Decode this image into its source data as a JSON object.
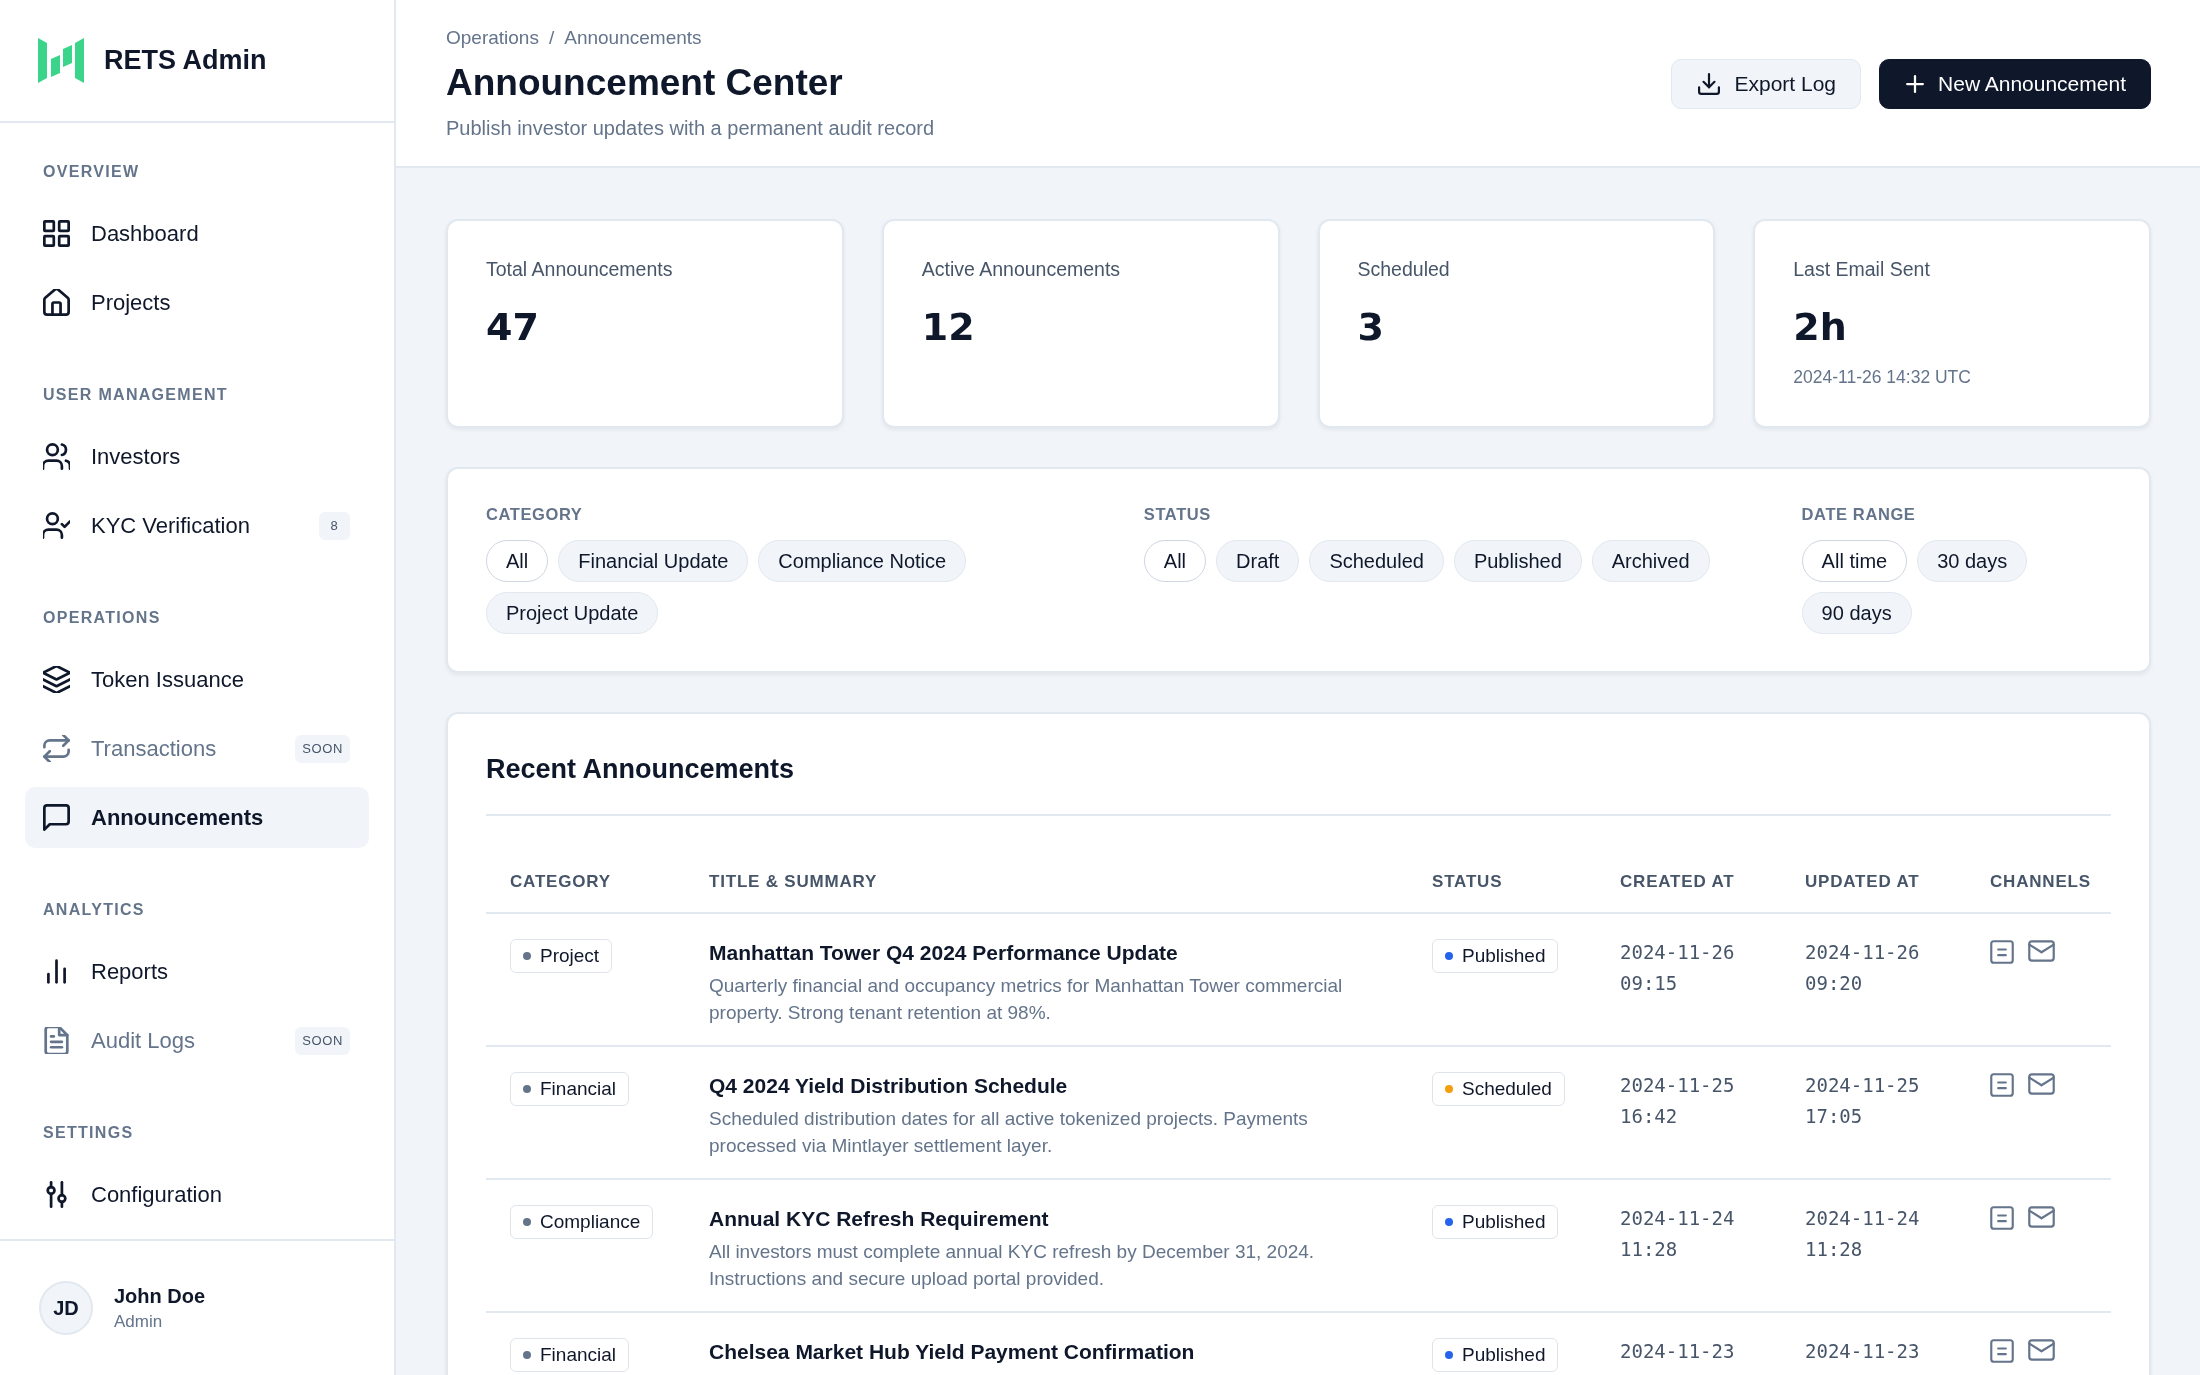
{
  "brand": {
    "name": "RETS Admin"
  },
  "sidebar": {
    "sections": [
      {
        "title": "OVERVIEW",
        "items": [
          {
            "label": "Dashboard",
            "selected": false,
            "disabled": false
          },
          {
            "label": "Projects",
            "selected": false,
            "disabled": false
          }
        ]
      },
      {
        "title": "USER MANAGEMENT",
        "items": [
          {
            "label": "Investors",
            "selected": false,
            "disabled": false
          },
          {
            "label": "KYC Verification",
            "selected": false,
            "disabled": false,
            "badge": "8"
          }
        ]
      },
      {
        "title": "OPERATIONS",
        "items": [
          {
            "label": "Token Issuance",
            "selected": false,
            "disabled": false
          },
          {
            "label": "Transactions",
            "selected": false,
            "disabled": true,
            "badge": "SOON"
          },
          {
            "label": "Announcements",
            "selected": true,
            "disabled": false
          }
        ]
      },
      {
        "title": "ANALYTICS",
        "items": [
          {
            "label": "Reports",
            "selected": false,
            "disabled": false
          },
          {
            "label": "Audit Logs",
            "selected": false,
            "disabled": true,
            "badge": "SOON"
          }
        ]
      },
      {
        "title": "SETTINGS",
        "items": [
          {
            "label": "Configuration",
            "selected": false,
            "disabled": false
          }
        ]
      }
    ]
  },
  "user": {
    "initials": "JD",
    "name": "John Doe",
    "role": "Admin"
  },
  "header": {
    "breadcrumb": [
      "Operations",
      "Announcements"
    ],
    "breadcrumb_separator": "/",
    "title": "Announcement Center",
    "subtitle": "Publish investor updates with a permanent audit record",
    "buttons": [
      {
        "label": "Export Log",
        "kind": "secondary"
      },
      {
        "label": "New Announcement",
        "kind": "primary"
      }
    ]
  },
  "stats": [
    {
      "label": "Total Announcements",
      "value": "47"
    },
    {
      "label": "Active Announcements",
      "value": "12"
    },
    {
      "label": "Scheduled",
      "value": "3"
    },
    {
      "label": "Last Email Sent",
      "value": "2h",
      "detail": "2024-11-26 14:32 UTC"
    }
  ],
  "filters": [
    {
      "title": "CATEGORY",
      "options": [
        {
          "label": "All",
          "selected": true
        },
        {
          "label": "Financial Update",
          "selected": false
        },
        {
          "label": "Compliance Notice",
          "selected": false
        },
        {
          "label": "Project Update",
          "selected": false
        }
      ]
    },
    {
      "title": "STATUS",
      "options": [
        {
          "label": "All",
          "selected": true
        },
        {
          "label": "Draft",
          "selected": false
        },
        {
          "label": "Scheduled",
          "selected": false
        },
        {
          "label": "Published",
          "selected": false
        },
        {
          "label": "Archived",
          "selected": false
        }
      ]
    },
    {
      "title": "DATE RANGE",
      "options": [
        {
          "label": "All time",
          "selected": true
        },
        {
          "label": "30 days",
          "selected": false
        },
        {
          "label": "90 days",
          "selected": false
        }
      ]
    }
  ],
  "table": {
    "title": "Recent Announcements",
    "columns": [
      "CATEGORY",
      "TITLE & SUMMARY",
      "STATUS",
      "CREATED AT",
      "UPDATED AT",
      "CHANNELS"
    ],
    "rows": [
      {
        "category": "Project",
        "title": "Manhattan Tower Q4 2024 Performance Update",
        "summary": "Quarterly financial and occupancy metrics for Manhattan Tower commercial property. Strong tenant retention at 98%.",
        "status": {
          "label": "Published",
          "color": "#2563eb"
        },
        "created_at": "2024-11-26 09:15",
        "updated_at": "2024-11-26 09:20"
      },
      {
        "category": "Financial",
        "title": "Q4 2024 Yield Distribution Schedule",
        "summary": "Scheduled distribution dates for all active tokenized projects. Payments processed via Mintlayer settlement layer.",
        "status": {
          "label": "Scheduled",
          "color": "#f59e0b"
        },
        "created_at": "2024-11-25 16:42",
        "updated_at": "2024-11-25 17:05"
      },
      {
        "category": "Compliance",
        "title": "Annual KYC Refresh Requirement",
        "summary": "All investors must complete annual KYC refresh by December 31, 2024. Instructions and secure upload portal provided.",
        "status": {
          "label": "Published",
          "color": "#2563eb"
        },
        "created_at": "2024-11-24 11:28",
        "updated_at": "2024-11-24 11:28"
      },
      {
        "category": "Financial",
        "title": "Chelsea Market Hub Yield Payment Confirmation",
        "status": {
          "label": "Published",
          "color": "#2563eb"
        },
        "created_at": "2024-11-23",
        "updated_at": "2024-11-23"
      }
    ]
  }
}
